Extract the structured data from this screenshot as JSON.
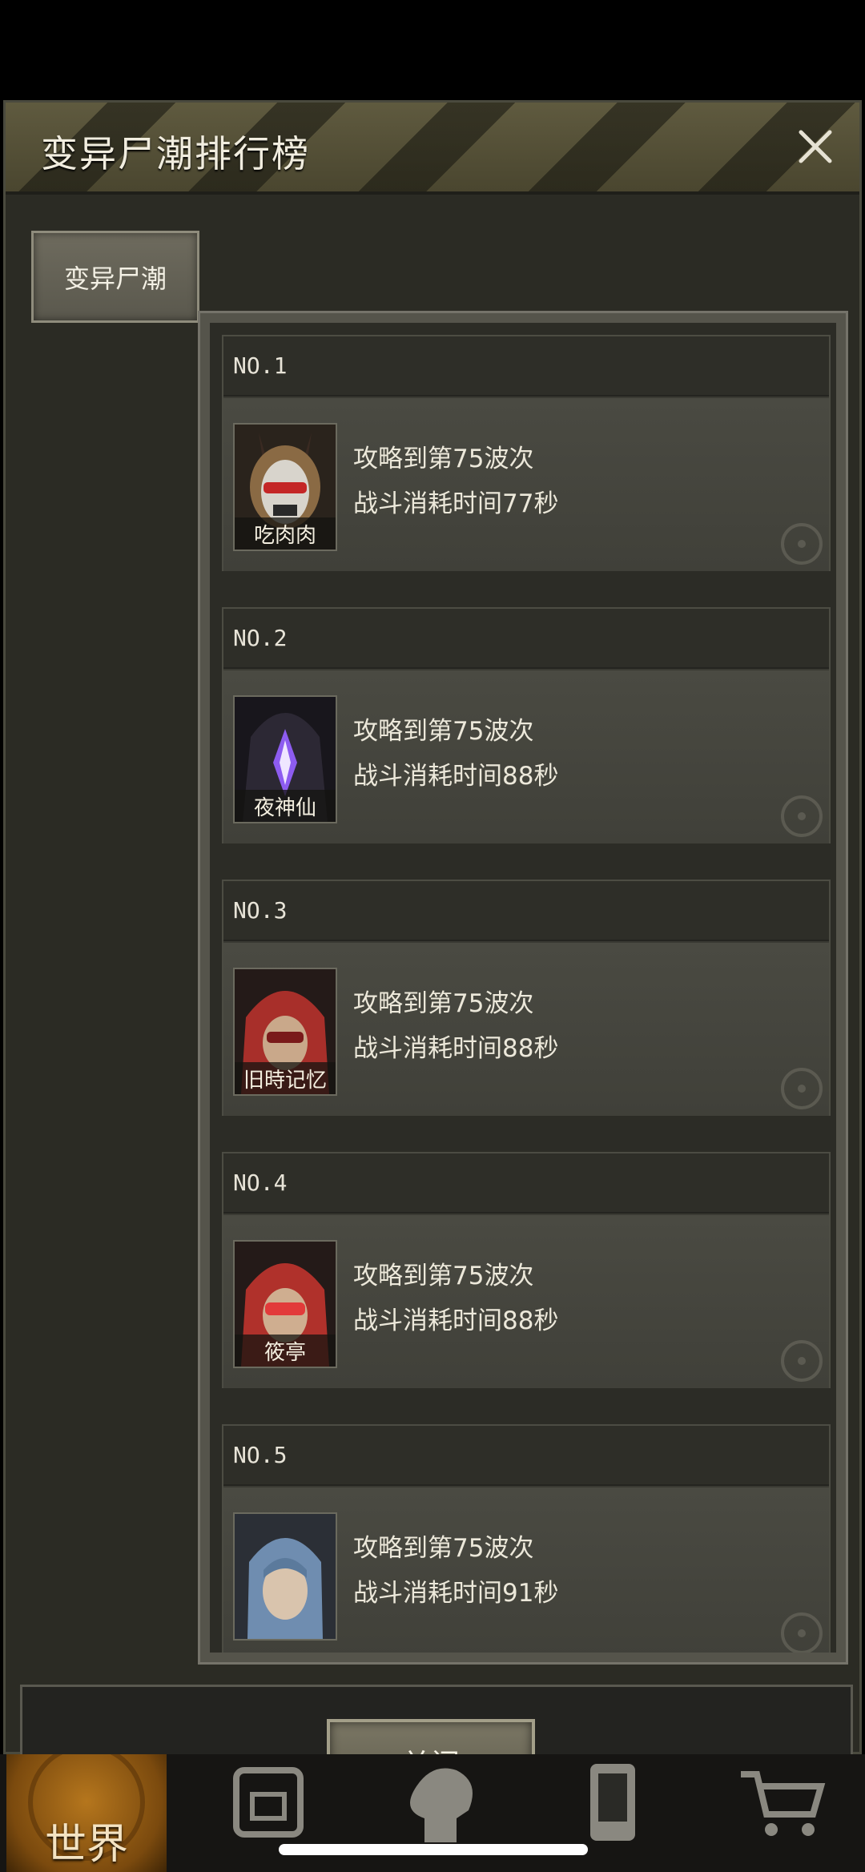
{
  "dialog": {
    "title": "变异尸潮排行榜",
    "tab_label": "变异尸潮",
    "close_button_label": "关闭"
  },
  "rankings": [
    {
      "rank": "NO.1",
      "name": "吃肉肉",
      "wave_text": "攻略到第75波次",
      "time_text": "战斗消耗时间77秒"
    },
    {
      "rank": "NO.2",
      "name": "夜神仙",
      "wave_text": "攻略到第75波次",
      "time_text": "战斗消耗时间88秒"
    },
    {
      "rank": "NO.3",
      "name": "旧時记忆",
      "wave_text": "攻略到第75波次",
      "time_text": "战斗消耗时间88秒"
    },
    {
      "rank": "NO.4",
      "name": "筱亭",
      "wave_text": "攻略到第75波次",
      "time_text": "战斗消耗时间88秒"
    },
    {
      "rank": "NO.5",
      "name": "",
      "wave_text": "攻略到第75波次",
      "time_text": "战斗消耗时间91秒"
    }
  ],
  "bottom_nav": {
    "world_label": "世界",
    "icons": [
      "world-icon",
      "backpack-icon",
      "skill-head-icon",
      "phone-icon",
      "cart-icon"
    ]
  },
  "colors": {
    "panel_bg": "#2b2b24",
    "header_bar": "#5f5a3f",
    "card_bg": "#3a3a33",
    "nav_world_accent": "#b5761d"
  }
}
